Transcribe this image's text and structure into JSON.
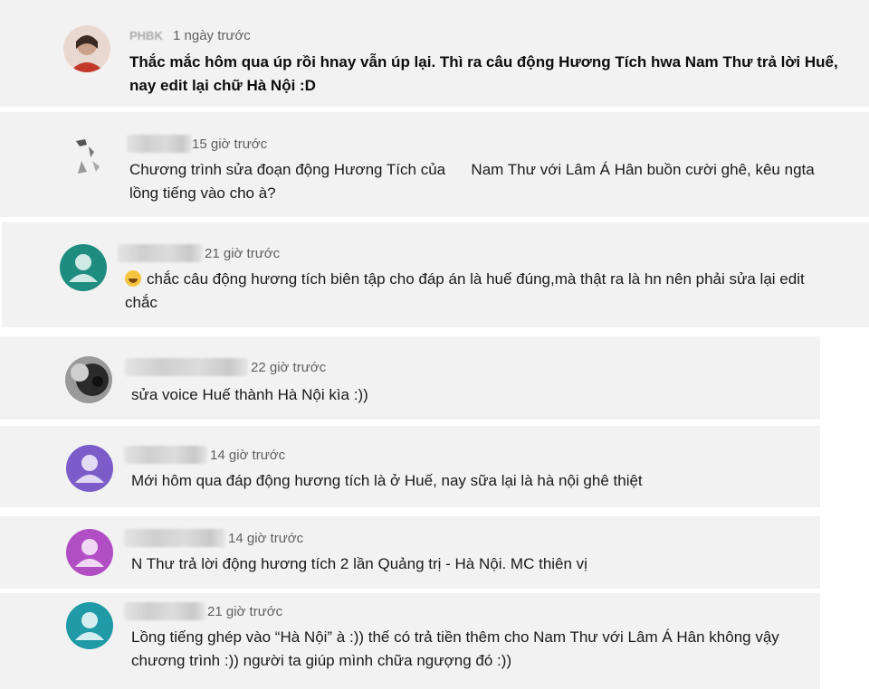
{
  "comments": [
    {
      "author": "PHBK",
      "time": "1 ngày trước",
      "text": "Thắc mắc hôm qua úp rồi hnay vẫn úp lại. Thì ra câu động Hương Tích hwa Nam Thư trả lời Huế, nay edit lại chữ Hà Nội :D",
      "avatar_type": "photo",
      "avatar_color": "#c96a5a"
    },
    {
      "author": "",
      "time": "15 giờ trước",
      "text": "Chương trình sửa đoạn động Hương Tích của      Nam Thư với Lâm Á Hân buồn cười ghê, kêu ngta lồng tiếng vào cho à?",
      "avatar_type": "sketch",
      "avatar_color": "#bbbbbb"
    },
    {
      "author": "",
      "time": "21 giờ trước",
      "text": "chắc câu động hương tích biên tập cho đáp án là huế đúng,mà thật ra là hn nên phải sửa lại edit chắc",
      "emoji": "tears-of-joy-emoji",
      "avatar_type": "default",
      "avatar_color": "#1e8c7e"
    },
    {
      "author": "",
      "time": "22 giờ trước",
      "text": "sửa voice Huế thành Hà Nội kìa :))",
      "avatar_type": "photo-dark",
      "avatar_color": "#3a3a3a"
    },
    {
      "author": "",
      "time": "14 giờ trước",
      "text": "Mới hôm qua đáp động hương tích là ở Huế, nay sữa lại là hà nội ghê thiệt",
      "avatar_type": "default",
      "avatar_color": "#7b5cc9"
    },
    {
      "author": "",
      "time": "14 giờ trước",
      "text": "N Thư trả lời động hương tích 2 lần Quảng trị - Hà Nội. MC thiên vị",
      "avatar_type": "default",
      "avatar_color": "#b24ec4"
    },
    {
      "author": "",
      "time": "21 giờ trước",
      "text": "Lồng tiếng ghép vào “Hà Nội” à :)) thế có trả tiền thêm cho Nam Thư với Lâm Á Hân không vậy chương trình :)) người ta giúp mình chữa ngượng đó :))",
      "avatar_type": "default",
      "avatar_color": "#1f9aa6"
    }
  ]
}
